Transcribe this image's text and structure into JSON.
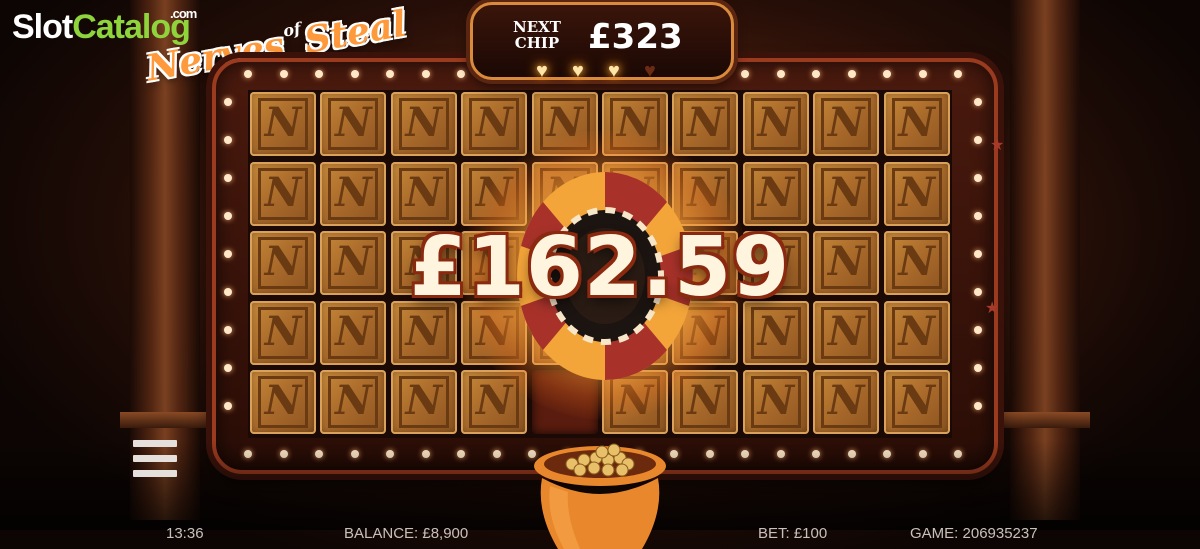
{
  "watermark": {
    "name_part1": "Slot",
    "name_part2": "Catalog",
    "suffix": ".com"
  },
  "game_logo": {
    "word1": "Nerves",
    "word2": "of",
    "word3": "Steal"
  },
  "next_chip": {
    "label_line1": "NEXT",
    "label_line2": "CHIP",
    "value": "£323"
  },
  "hearts": {
    "filled": 3,
    "total": 4
  },
  "win_amount": "£162.59",
  "status_bar": {
    "time": "13:36",
    "balance": "BALANCE: £8,900",
    "bet": "BET: £100",
    "game": "GAME: 206935237"
  },
  "grid": {
    "rows": 5,
    "cols": 10,
    "tile_letter": "N",
    "open_tiles": [
      [
        4,
        4
      ]
    ]
  },
  "icons": {
    "menu": "hamburger-menu-icon",
    "pot": "coin-pot-icon",
    "chip": "casino-chip-icon"
  }
}
